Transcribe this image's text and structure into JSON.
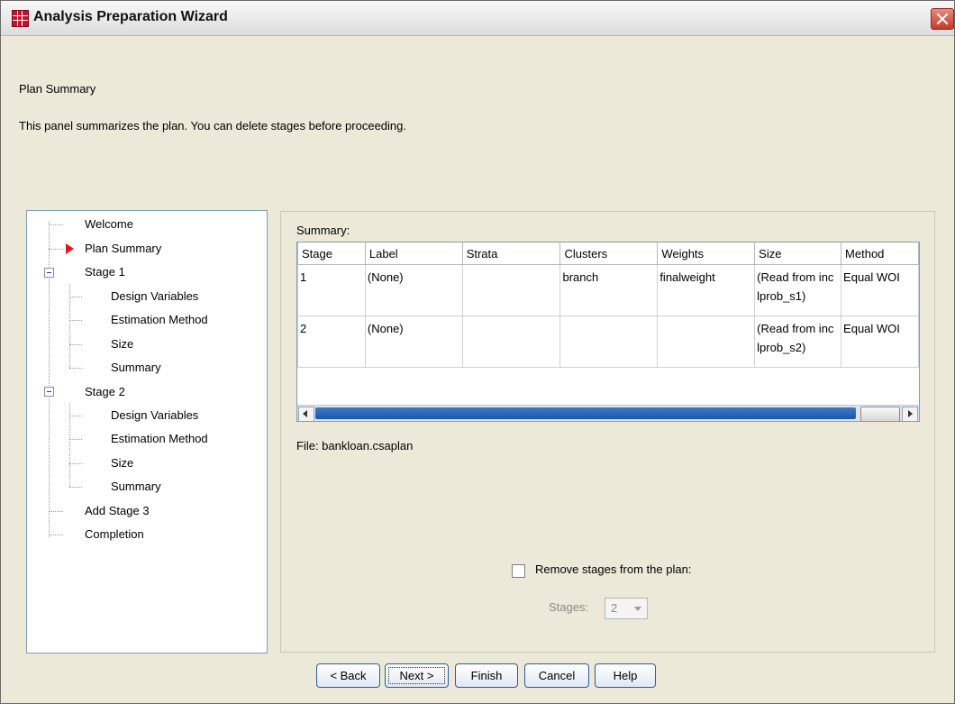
{
  "window": {
    "title": "Analysis Preparation Wizard",
    "title_icon": "grid-table-icon",
    "close_icon": "close-icon"
  },
  "page": {
    "heading": "Plan Summary",
    "description": "This panel summarizes the plan. You can delete stages before proceeding."
  },
  "nav": {
    "items": [
      {
        "label": "Welcome"
      },
      {
        "label": "Plan Summary",
        "current": true
      },
      {
        "label": "Stage 1"
      },
      {
        "label": "Design Variables"
      },
      {
        "label": "Estimation Method"
      },
      {
        "label": "Size"
      },
      {
        "label": "Summary"
      },
      {
        "label": "Stage 2"
      },
      {
        "label": "Design Variables"
      },
      {
        "label": "Estimation Method"
      },
      {
        "label": "Size"
      },
      {
        "label": "Summary"
      },
      {
        "label": "Add Stage 3"
      },
      {
        "label": "Completion"
      }
    ]
  },
  "summary": {
    "label": "Summary:",
    "columns": [
      "Stage",
      "Label",
      "Strata",
      "Clusters",
      "Weights",
      "Size",
      "Method"
    ],
    "rows": [
      [
        "1",
        "(None)",
        "",
        "branch",
        "finalweight",
        "(Read from inc\nlprob_s1)",
        "Equal WOI"
      ],
      [
        "2",
        "(None)",
        "",
        "",
        "",
        "(Read from inc\nlprob_s2)",
        "Equal WOI"
      ]
    ],
    "file_label": "File:  bankloan.csaplan"
  },
  "options": {
    "remove_stages_label": "Remove stages from the plan:",
    "remove_stages_checked": false,
    "stages_label": "Stages:",
    "stages_value": "2"
  },
  "buttons": {
    "back": "< Back",
    "next": "Next >",
    "finish": "Finish",
    "cancel": "Cancel",
    "help": "Help"
  },
  "colors": {
    "accent": "#2b5b9c",
    "current_arrow": "#e0191b",
    "scrollbar": "#1e55a8"
  }
}
